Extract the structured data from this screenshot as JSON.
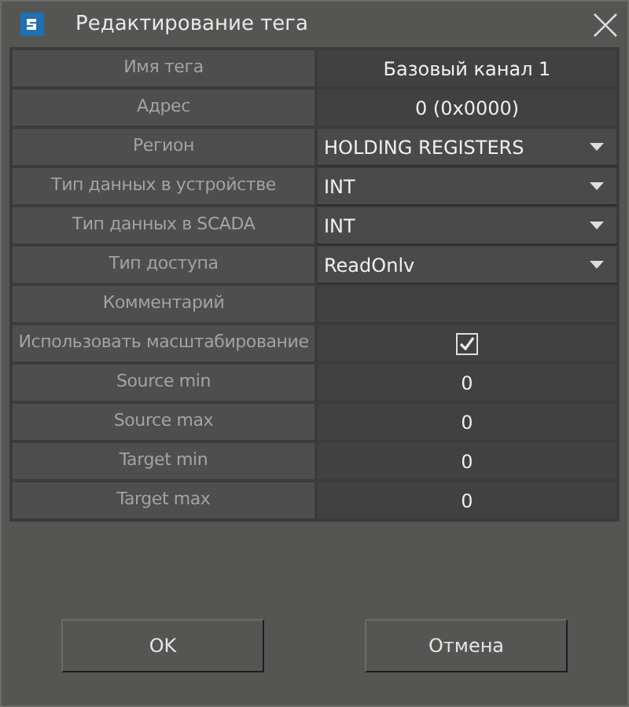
{
  "window": {
    "title": "Редактирование тега"
  },
  "rows": [
    {
      "label": "Имя тега",
      "kind": "text",
      "value": "Базовый канал 1"
    },
    {
      "label": "Адрес",
      "kind": "text",
      "value": "0 (0x0000)"
    },
    {
      "label": "Регион",
      "kind": "select",
      "value": "HOLDING  REGISTERS"
    },
    {
      "label": "Тип данных в устройстве",
      "kind": "select",
      "value": "INT"
    },
    {
      "label": "Тип данных в SCADA",
      "kind": "select",
      "value": "INT"
    },
    {
      "label": "Тип доступа",
      "kind": "select",
      "value": "ReadOnlv"
    },
    {
      "label": "Комментарий",
      "kind": "field"
    },
    {
      "label": "Использовать масштабирование",
      "kind": "checkbox",
      "checked": true
    },
    {
      "label": "Source min",
      "kind": "text",
      "value": "0"
    },
    {
      "label": "Source max",
      "kind": "text",
      "value": "0"
    },
    {
      "label": "Target min",
      "kind": "text",
      "value": "0"
    },
    {
      "label": "Target max",
      "kind": "text",
      "value": "0"
    }
  ],
  "buttons": [
    "OK",
    "Отмена"
  ]
}
